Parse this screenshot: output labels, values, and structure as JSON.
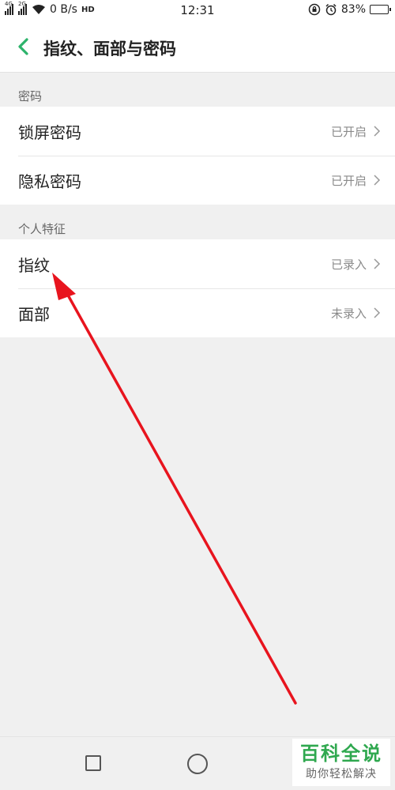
{
  "status_bar": {
    "net_1": "4G",
    "net_2": "2G",
    "speed": "0 B/s",
    "hd": "HD",
    "time": "12:31",
    "battery_percent": "83%",
    "battery_level": 0.83,
    "icons": [
      "signal-icon",
      "signal-icon",
      "wifi-icon",
      "hd-call-icon",
      "rotation-lock-icon",
      "alarm-icon",
      "battery-icon"
    ]
  },
  "header": {
    "back_icon": "chevron-left-icon",
    "title": "指纹、面部与密码",
    "accent_color": "#2db36b"
  },
  "sections": [
    {
      "label": "密码",
      "items": [
        {
          "label": "锁屏密码",
          "value": "已开启"
        },
        {
          "label": "隐私密码",
          "value": "已开启"
        }
      ]
    },
    {
      "label": "个人特征",
      "items": [
        {
          "label": "指纹",
          "value": "已录入"
        },
        {
          "label": "面部",
          "value": "未录入"
        }
      ]
    }
  ],
  "annotation": {
    "color": "#e8141e",
    "description_icon": "red-arrow-icon"
  },
  "nav_bar": {
    "icons": [
      "recent-apps-icon",
      "home-icon"
    ]
  },
  "watermark": {
    "main": "百科全说",
    "sub": "助你轻松解决",
    "color": "#2fa84f"
  }
}
